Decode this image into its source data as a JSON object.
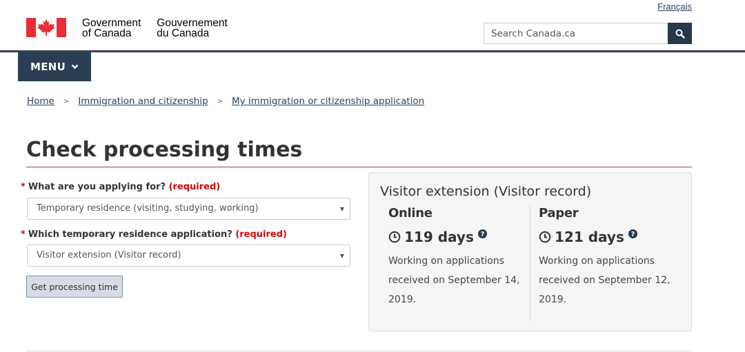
{
  "header": {
    "language_link": "Français",
    "wordmark_en": "Government\nof Canada",
    "wordmark_fr": "Gouvernement\ndu Canada",
    "search_placeholder": "Search Canada.ca",
    "menu_label": "MENU"
  },
  "breadcrumb": [
    "Home",
    "Immigration and citizenship",
    "My immigration or citizenship application"
  ],
  "page": {
    "title": "Check processing times"
  },
  "form": {
    "q1_label": "What are you applying for?",
    "q1_required": "(required)",
    "q1_value": "Temporary residence (visiting, studying, working)",
    "q2_label": "Which temporary residence application?",
    "q2_required": "(required)",
    "q2_value": "Visitor extension (Visitor record)",
    "submit_label": "Get processing time"
  },
  "result": {
    "title": "Visitor extension (Visitor record)",
    "online": {
      "heading": "Online",
      "days": "119 days",
      "description": "Working on applications received on September 14, 2019."
    },
    "paper": {
      "heading": "Paper",
      "days": "121 days",
      "description": "Working on applications received on September 12, 2019."
    }
  },
  "colors": {
    "flag_red": "#eb2d37",
    "header_navy": "#26374a",
    "required_red": "#d3080c",
    "title_rule": "#af3c43",
    "link_blue": "#284162"
  }
}
